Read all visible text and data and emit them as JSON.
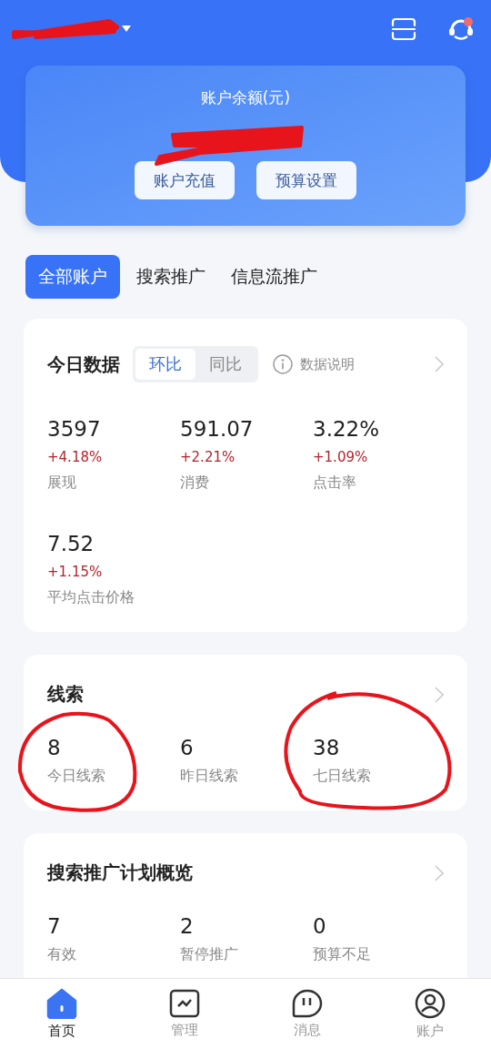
{
  "header": {
    "balance_label": "账户余额(元)",
    "buttons": [
      "账户充值",
      "预算设置"
    ]
  },
  "account_tabs": [
    {
      "label": "全部账户",
      "selected": true
    },
    {
      "label": "搜索推广",
      "selected": false
    },
    {
      "label": "信息流推广",
      "selected": false
    }
  ],
  "today_data": {
    "title": "今日数据",
    "compare_tabs": [
      {
        "label": "环比",
        "selected": true
      },
      {
        "label": "同比",
        "selected": false
      }
    ],
    "info_link": "数据说明",
    "metrics": [
      {
        "value": "3597",
        "change": "+4.18%",
        "label": "展现"
      },
      {
        "value": "591.07",
        "change": "+2.21%",
        "label": "消费"
      },
      {
        "value": "3.22%",
        "change": "+1.09%",
        "label": "点击率"
      },
      {
        "value": "7.52",
        "change": "+1.15%",
        "label": "平均点击价格"
      }
    ]
  },
  "leads": {
    "title": "线索",
    "stats": [
      {
        "value": "8",
        "label": "今日线索"
      },
      {
        "value": "6",
        "label": "昨日线索"
      },
      {
        "value": "38",
        "label": "七日线索"
      }
    ]
  },
  "search_plan": {
    "title": "搜索推广计划概览",
    "stats": [
      {
        "value": "7",
        "label": "有效"
      },
      {
        "value": "2",
        "label": "暂停推广"
      },
      {
        "value": "0",
        "label": "预算不足"
      }
    ]
  },
  "bottom_nav": [
    {
      "label": "首页",
      "kind": "home",
      "selected": true
    },
    {
      "label": "管理",
      "kind": "chart",
      "selected": false
    },
    {
      "label": "消息",
      "kind": "message",
      "selected": false
    },
    {
      "label": "账户",
      "kind": "user",
      "selected": false
    }
  ]
}
